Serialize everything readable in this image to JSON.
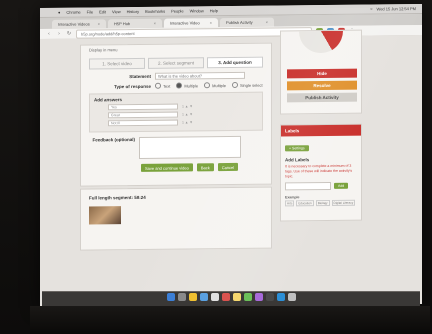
{
  "menubar": {
    "items": [
      "Chrome",
      "File",
      "Edit",
      "View",
      "History",
      "Bookmarks",
      "People",
      "Window",
      "Help"
    ],
    "clock": "Wed 15 Jun 12:54 PM"
  },
  "tabs": [
    {
      "label": "Interactive Videos"
    },
    {
      "label": "H5P Hub"
    },
    {
      "label": "Interactive Video"
    },
    {
      "label": "Publish Activity"
    }
  ],
  "address": {
    "url": "h5p.org/node/add/h5p-content"
  },
  "form": {
    "meta_label": "Display in menu",
    "steps": [
      "1. Select video",
      "2. Select segment",
      "3. Add question"
    ],
    "statement_label": "Statement",
    "statement_placeholder": "What is the video about?",
    "type_label": "Type of response",
    "type_options": [
      "Text",
      "Multiple",
      "Multiple",
      "Single select"
    ],
    "answers_title": "Add answers",
    "answers": [
      "Yes",
      "Great",
      "Not Ill"
    ],
    "answer_controls": "1 ▲ ▼",
    "feedback_label": "Feedback (optional)",
    "buttons": [
      "Save and continue video",
      "Back",
      "Cancel"
    ]
  },
  "below": {
    "title": "Full length segment: 58:24"
  },
  "right_panel": {
    "btn_hide": "Hide",
    "btn_resolve": "Resolve",
    "btn_publish": "Publish Activity",
    "labels_header": "Labels",
    "add_pill": "+ Settings",
    "add_labels_title": "Add Labels",
    "help_text": "It is necessary to complete a minimum of 3 tags. Use of these will indicate the activity's topic.",
    "add_button": "Add",
    "example_title": "Example",
    "example_tags": [
      "Arts",
      "Education",
      "Biology",
      "Digital Literacy"
    ]
  },
  "colors": {
    "accent_red": "#c9302c",
    "accent_green": "#7aa23c",
    "orange": "#e0912c"
  }
}
